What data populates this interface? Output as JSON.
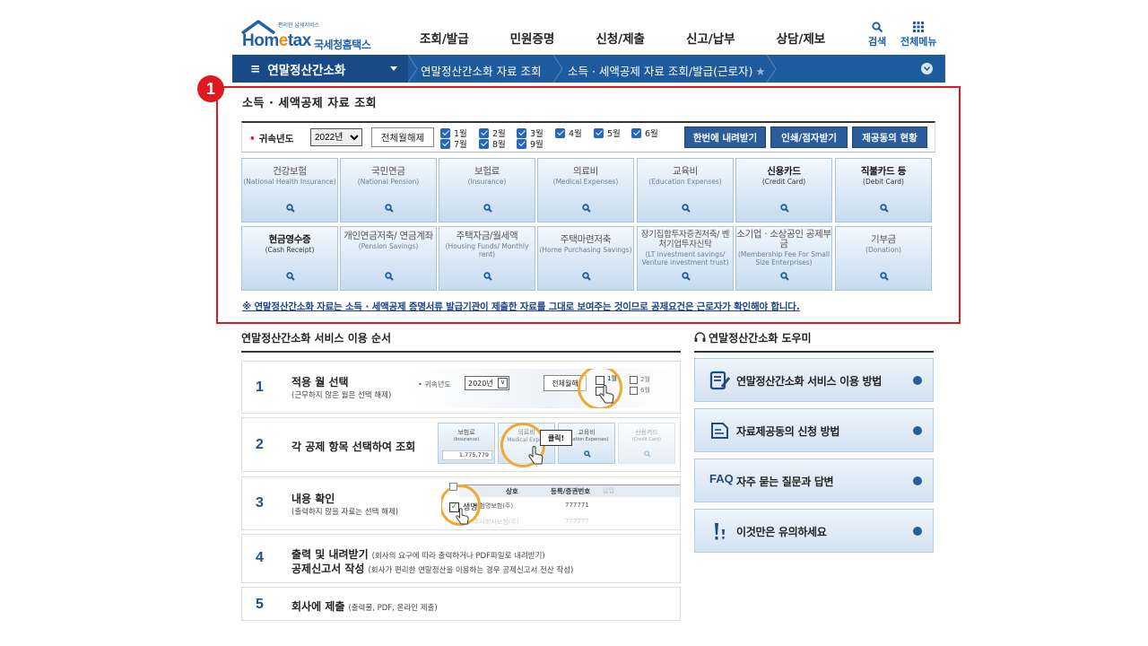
{
  "header": {
    "brand_main": "Hom",
    "brand_e": "e",
    "brand_tax": "tax",
    "brand_tagline": "편리한 납세서비스",
    "brand_kr": "국세청홈택스",
    "nav": [
      "조회/발급",
      "민원증명",
      "신청/제출",
      "신고/납부",
      "상담/제보"
    ],
    "search_label": "검색",
    "allmenu_label": "전체메뉴"
  },
  "navbar": {
    "menu_label": "연말정산간소화",
    "crumb1": "연말정산간소화 자료 조회",
    "crumb2": "소득 · 세액공제 자료 조회/발급(근로자)"
  },
  "annotation": {
    "badge": "1"
  },
  "section_title": "소득 · 세액공제 자료 조회",
  "filter": {
    "year_label": "귀속년도",
    "year_value": "2022년",
    "clear_label": "전체월해제",
    "months": [
      "1월",
      "2월",
      "3월",
      "4월",
      "5월",
      "6월",
      "7월",
      "8월",
      "9월"
    ],
    "btn_download": "한번에 내려받기",
    "btn_print": "인쇄/점자받기",
    "btn_share": "제공동의 현황"
  },
  "tiles": [
    {
      "kr": "건강보험",
      "en": "(National Health Insurance)",
      "active": false
    },
    {
      "kr": "국민연금",
      "en": "(National Pension)",
      "active": false
    },
    {
      "kr": "보험료",
      "en": "(Insurance)",
      "active": false
    },
    {
      "kr": "의료비",
      "en": "(Medical Expenses)",
      "active": false
    },
    {
      "kr": "교육비",
      "en": "(Education Expenses)",
      "active": false
    },
    {
      "kr": "신용카드",
      "en": "(Credit Card)",
      "active": true
    },
    {
      "kr": "직불카드 등",
      "en": "(Debit Card)",
      "active": true
    },
    {
      "kr": "현금영수증",
      "en": "(Cash Receipt)",
      "active": true
    },
    {
      "kr": "개인연금저축/ 연금계좌",
      "en": "(Pension Savings)",
      "active": false
    },
    {
      "kr": "주택자금/월세액",
      "en": "(Housing Funds/ Monthly rent)",
      "active": false
    },
    {
      "kr": "주택마련저축",
      "en": "(Home Purchasing Savings)",
      "active": false
    },
    {
      "kr": "장기집합투자증권저축/ 벤처기업투자신탁",
      "en": "(LT investment savings/ Venture investment trust)",
      "active": false
    },
    {
      "kr": "소기업 · 소상공인 공제부금",
      "en": "(Membership Fee For Small Size Enterprises)",
      "active": false
    },
    {
      "kr": "기부금",
      "en": "(Donation)",
      "active": false
    }
  ],
  "notice": "※ 연말정산간소화 자료는 소득 · 세액공제 증명서류 발급기관이 제출한 자료를 그대로 보여주는 것이므로 공제요건은 근로자가 확인해야 합니다.",
  "steps_title": "연말정산간소화 서비스 이용 순서",
  "steps": [
    {
      "num": "1",
      "title": "적용 월 선택",
      "sub": "(근무하지 않은 월은 선택 해제)"
    },
    {
      "num": "2",
      "title": "각 공제 항목 선택하여 조회",
      "sub": ""
    },
    {
      "num": "3",
      "title": "내용 확인",
      "sub": "(출력하지 않을 자료는 선택 해제)"
    },
    {
      "num": "4",
      "title": "출력 및 내려받기",
      "title2": "공제신고서 작성",
      "note1": "(회사의 요구에 따라 출력하거나 PDF파일로 내려받기)",
      "note2": "(회사가 편리한 연말정산을 이용하는 경우 공제신고서 전산 작성)"
    },
    {
      "num": "5",
      "title": "회사에 제출",
      "note1": "(출력물, PDF, 온라인 제출)"
    }
  ],
  "illus": {
    "s1_label": "귀속년도",
    "s1_year": "2020년",
    "s1_clear": "전체월해",
    "s1_m1": "1월",
    "s1_m2": "2월",
    "s1_m3": "6월",
    "s2_t1": "보험료",
    "s2_t1e": "(Insurance)",
    "s2_t2": "의료비",
    "s2_t2e": "Medical Expen",
    "s2_t3": "교육비",
    "s2_t3e": "ducation Expenses)",
    "s2_t4": "신용카드",
    "s2_t4e": "(Credit Card)",
    "s2_amount": "1,775,779",
    "s2_click": "클릭!",
    "s3_h1": "상호",
    "s3_h2": "등록/증권번호",
    "s3_h3": "납입",
    "s3_row": "보험명보험(주)",
    "s3_row_no": "777771",
    "s3_row2": "주식회사보험(주)",
    "s3_row2_no": "777777",
    "s3_sel": "생명"
  },
  "helper_title": "연말정산간소화 도우미",
  "helpers": [
    {
      "label": "연말정산간소화 서비스 이용 방법",
      "icon": "guide-icon"
    },
    {
      "label": "자료제공동의 신청 방법",
      "icon": "document-icon"
    },
    {
      "label": "자주 묻는 질문과 답변",
      "icon": "faq-icon",
      "prefix": "FAQ"
    },
    {
      "label": "이것만은 유의하세요",
      "icon": "alert-icon"
    }
  ],
  "colors": {
    "primary": "#1e5b9e",
    "accent_red": "#e0191f",
    "highlight": "#f0a830"
  }
}
